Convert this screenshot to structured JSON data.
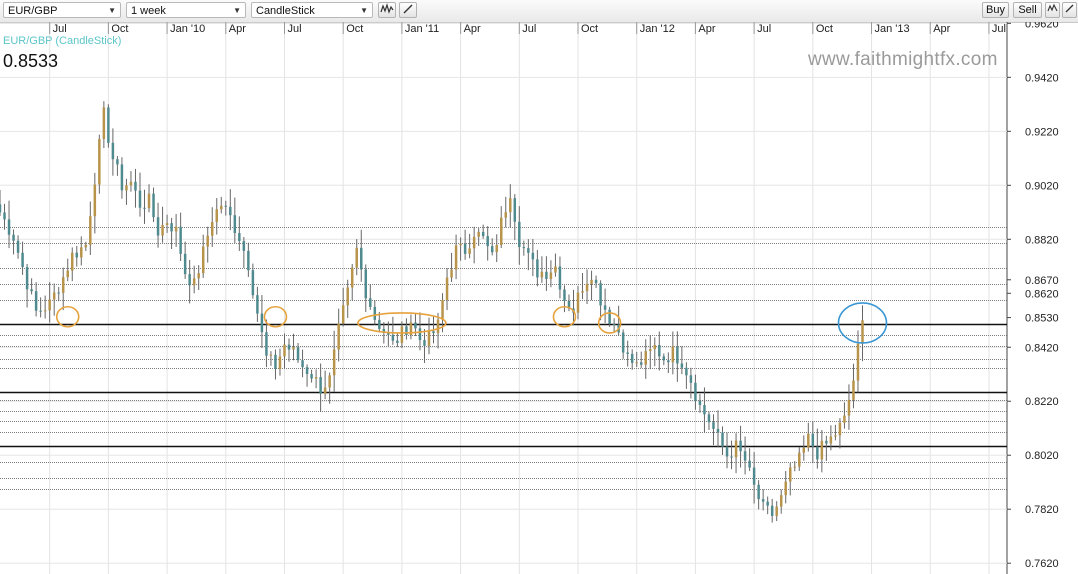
{
  "toolbar": {
    "symbol": "EUR/GBP",
    "interval": "1 week",
    "chart_type": "CandleStick",
    "buy_label": "Buy",
    "sell_label": "Sell"
  },
  "watermark": "www.faithmightfx.com",
  "colors": {
    "bull": "#b8934a",
    "bear": "#4f8a8f",
    "wick": "#666666",
    "series_label": "#5bc5c9",
    "circle_orange": "#e6a23c",
    "circle_blue": "#3a97d4"
  },
  "chart_data": {
    "type": "candlestick",
    "series_label": "EUR/GBP (CandleStick)",
    "last_price": "0.8533",
    "y_tick_labels": [
      "0.9620",
      "0.9420",
      "0.9220",
      "0.9020",
      "0.8820",
      "0.8670",
      "0.8620",
      "0.8530",
      "0.8420",
      "0.8220",
      "0.8020",
      "0.7820",
      "0.7620"
    ],
    "y_ticks": [
      0.962,
      0.942,
      0.922,
      0.902,
      0.882,
      0.867,
      0.862,
      0.853,
      0.842,
      0.822,
      0.802,
      0.782,
      0.762
    ],
    "ylim": [
      0.758,
      0.9625
    ],
    "x_tick_labels": [
      "Jul",
      "Oct",
      "Jan '10",
      "Apr",
      "Jul",
      "Oct",
      "Jan '11",
      "Apr",
      "Jul",
      "Oct",
      "Jan '12",
      "Apr",
      "Jul",
      "Oct",
      "Jan '13",
      "Apr",
      "Jul"
    ],
    "x_tick_weeks": [
      0,
      13,
      26,
      39,
      52,
      65,
      78,
      91,
      104,
      117,
      130,
      143,
      156,
      169,
      182,
      195,
      208
    ],
    "x_range_weeks": [
      -11,
      212
    ],
    "horizontal_levels_bold": [
      0.8505,
      0.8255,
      0.8055
    ],
    "horizontal_levels_dotted": [
      0.8865,
      0.8805,
      0.8715,
      0.8655,
      0.8595,
      0.8465,
      0.8425,
      0.8375,
      0.8345,
      0.8225,
      0.8185,
      0.8145,
      0.8105,
      0.7995,
      0.7935,
      0.7895
    ],
    "highlight_circles": [
      {
        "week": 4,
        "price": 0.8533,
        "color": "orange"
      },
      {
        "week": 50,
        "price": 0.8533,
        "color": "orange"
      },
      {
        "week": 78,
        "price": 0.851,
        "color": "orange"
      },
      {
        "week": 114,
        "price": 0.8533,
        "color": "orange"
      },
      {
        "week": 124,
        "price": 0.851,
        "color": "orange"
      },
      {
        "week": 180,
        "price": 0.851,
        "color": "blue"
      }
    ],
    "close_points": [
      [
        -11,
        0.892
      ],
      [
        -8,
        0.883
      ],
      [
        -5,
        0.866
      ],
      [
        -3,
        0.855
      ],
      [
        0,
        0.858
      ],
      [
        3,
        0.868
      ],
      [
        5,
        0.876
      ],
      [
        8,
        0.88
      ],
      [
        10,
        0.905
      ],
      [
        12,
        0.928
      ],
      [
        14,
        0.912
      ],
      [
        16,
        0.902
      ],
      [
        18,
        0.903
      ],
      [
        20,
        0.895
      ],
      [
        22,
        0.896
      ],
      [
        24,
        0.885
      ],
      [
        26,
        0.889
      ],
      [
        28,
        0.885
      ],
      [
        30,
        0.87
      ],
      [
        32,
        0.865
      ],
      [
        34,
        0.877
      ],
      [
        36,
        0.89
      ],
      [
        38,
        0.895
      ],
      [
        40,
        0.89
      ],
      [
        42,
        0.883
      ],
      [
        44,
        0.873
      ],
      [
        46,
        0.855
      ],
      [
        48,
        0.838
      ],
      [
        50,
        0.835
      ],
      [
        52,
        0.843
      ],
      [
        54,
        0.84
      ],
      [
        56,
        0.835
      ],
      [
        58,
        0.832
      ],
      [
        60,
        0.827
      ],
      [
        62,
        0.83
      ],
      [
        64,
        0.848
      ],
      [
        66,
        0.862
      ],
      [
        68,
        0.878
      ],
      [
        70,
        0.863
      ],
      [
        72,
        0.853
      ],
      [
        74,
        0.848
      ],
      [
        76,
        0.843
      ],
      [
        78,
        0.847
      ],
      [
        80,
        0.852
      ],
      [
        82,
        0.845
      ],
      [
        84,
        0.845
      ],
      [
        86,
        0.85
      ],
      [
        88,
        0.868
      ],
      [
        90,
        0.878
      ],
      [
        92,
        0.878
      ],
      [
        94,
        0.885
      ],
      [
        96,
        0.882
      ],
      [
        98,
        0.875
      ],
      [
        100,
        0.888
      ],
      [
        102,
        0.9
      ],
      [
        104,
        0.882
      ],
      [
        106,
        0.875
      ],
      [
        108,
        0.87
      ],
      [
        110,
        0.87
      ],
      [
        112,
        0.872
      ],
      [
        114,
        0.86
      ],
      [
        116,
        0.856
      ],
      [
        118,
        0.865
      ],
      [
        120,
        0.87
      ],
      [
        122,
        0.86
      ],
      [
        124,
        0.853
      ],
      [
        126,
        0.848
      ],
      [
        128,
        0.838
      ],
      [
        130,
        0.835
      ],
      [
        132,
        0.838
      ],
      [
        134,
        0.842
      ],
      [
        136,
        0.838
      ],
      [
        138,
        0.84
      ],
      [
        140,
        0.837
      ],
      [
        142,
        0.83
      ],
      [
        144,
        0.82
      ],
      [
        146,
        0.815
      ],
      [
        148,
        0.808
      ],
      [
        150,
        0.802
      ],
      [
        152,
        0.805
      ],
      [
        154,
        0.8
      ],
      [
        156,
        0.79
      ],
      [
        158,
        0.782
      ],
      [
        160,
        0.78
      ],
      [
        162,
        0.786
      ],
      [
        164,
        0.795
      ],
      [
        166,
        0.8
      ],
      [
        168,
        0.808
      ],
      [
        170,
        0.803
      ],
      [
        172,
        0.806
      ],
      [
        174,
        0.81
      ],
      [
        176,
        0.815
      ],
      [
        178,
        0.83
      ],
      [
        180,
        0.852
      ]
    ]
  }
}
